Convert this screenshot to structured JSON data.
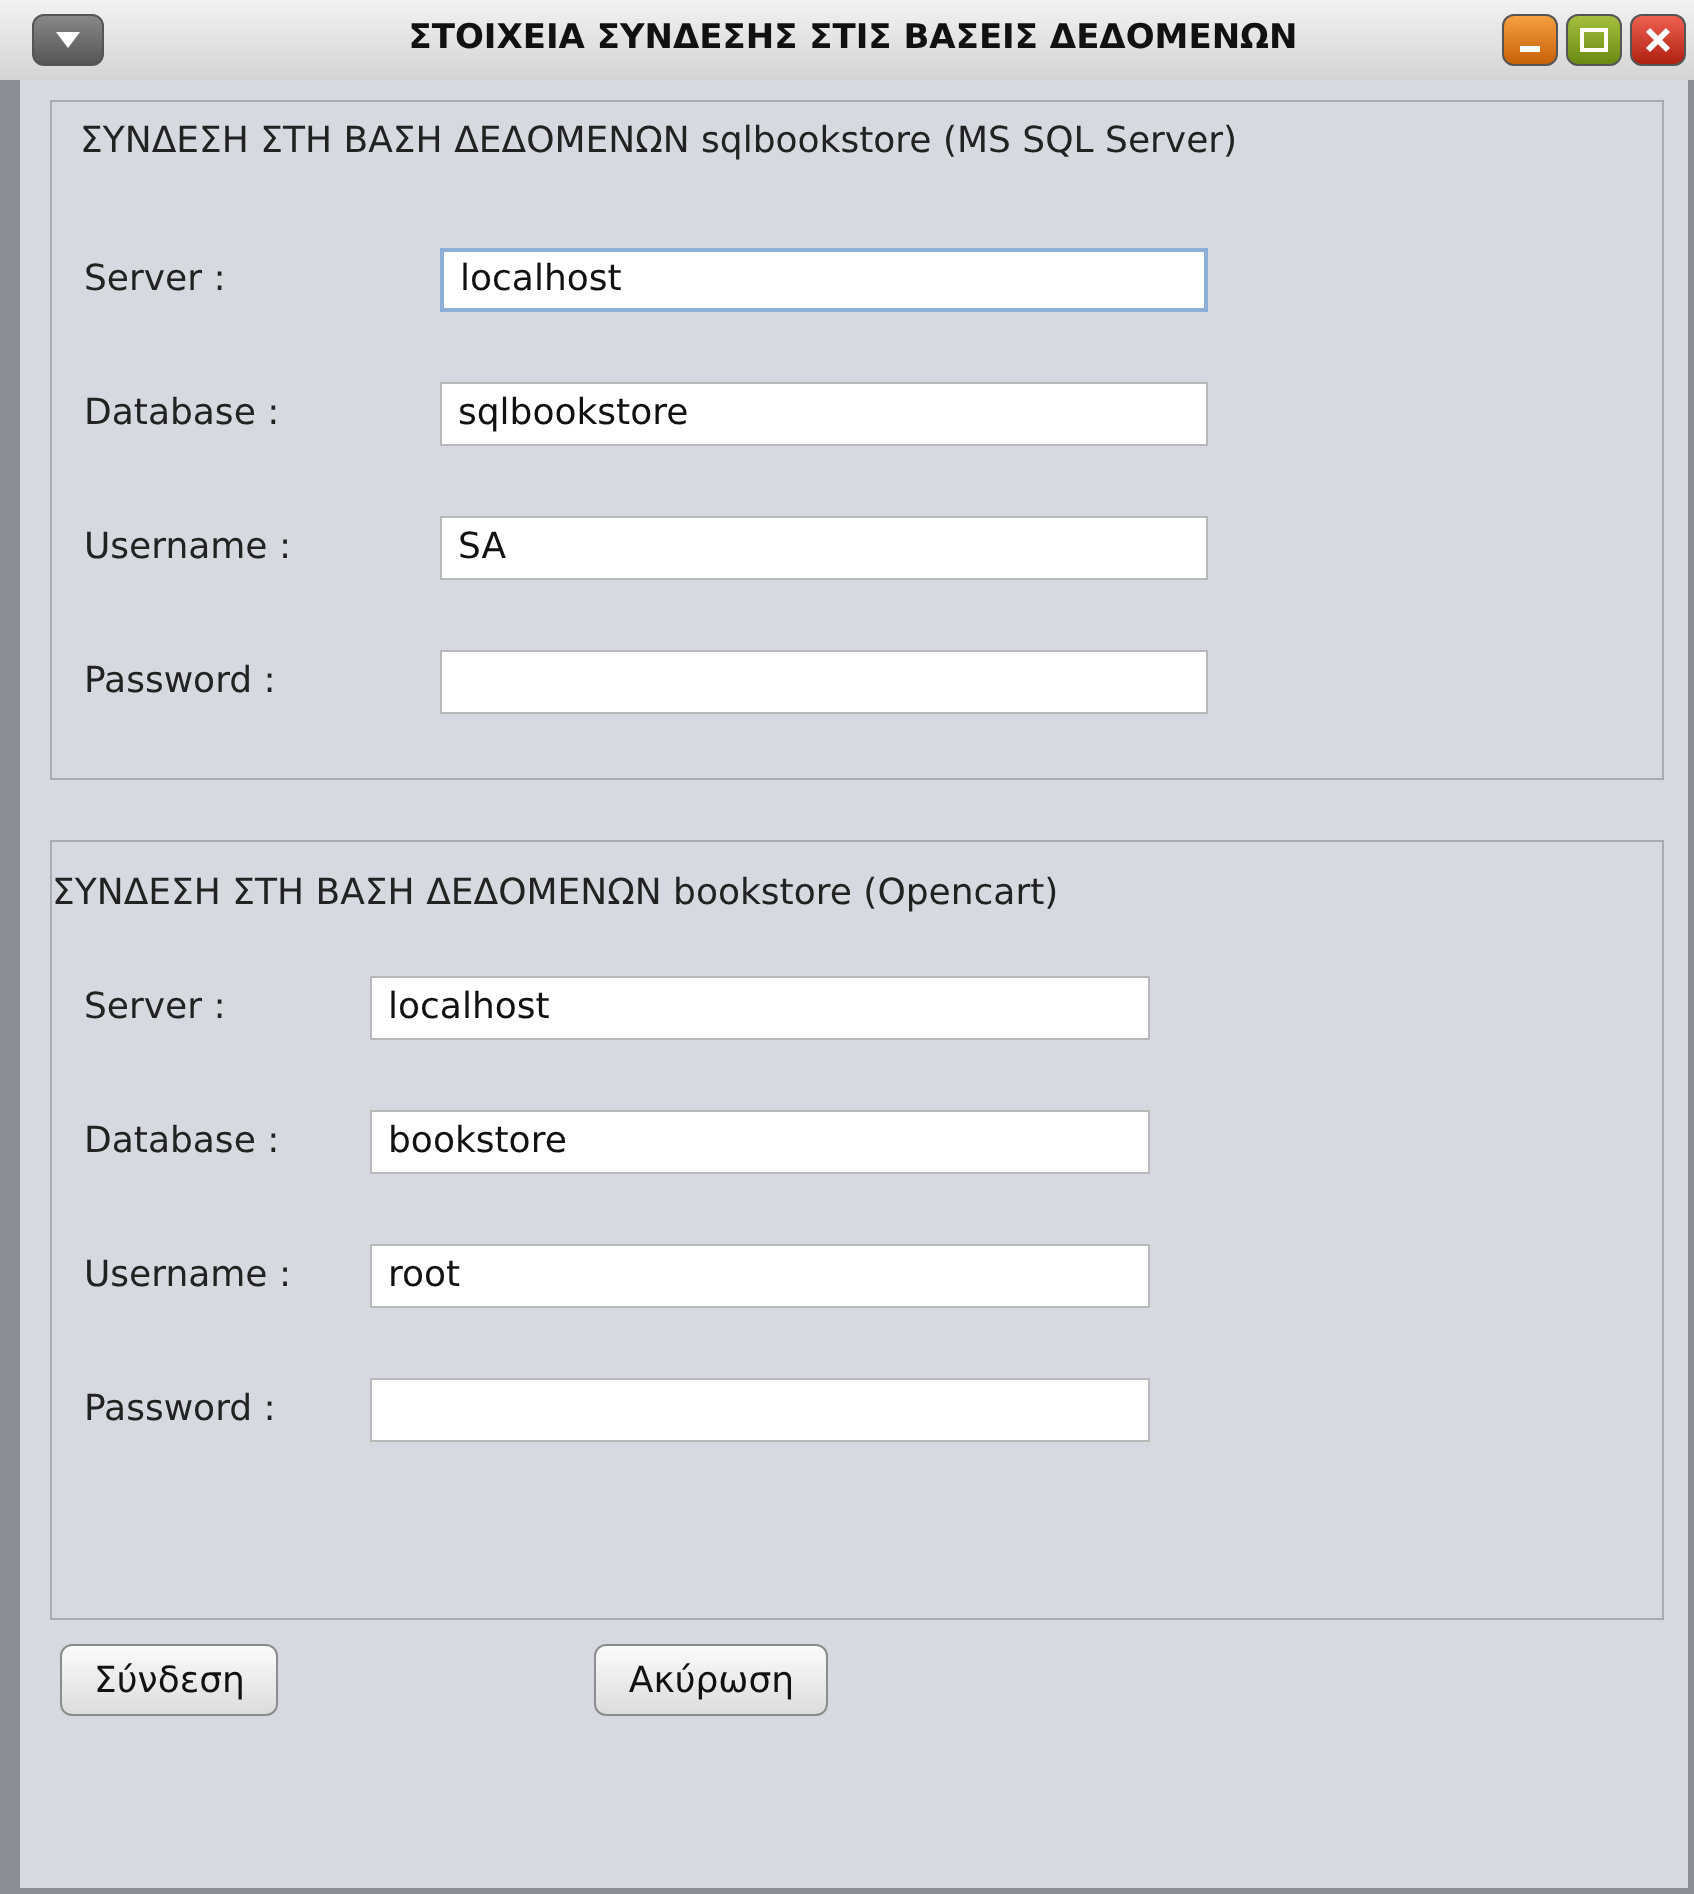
{
  "window": {
    "title": "ΣΤΟΙΧΕΙΑ ΣΥΝΔΕΣΗΣ ΣΤΙΣ ΒΑΣΕΙΣ ΔΕΔΟΜΕΝΩΝ"
  },
  "panels": [
    {
      "title": "ΣΥΝΔΕΣΗ ΣΤΗ ΒΑΣΗ ΔΕΔΟΜΕΝΩΝ sqlbookstore (MS SQL Server)",
      "fields": [
        {
          "label": "Server :",
          "value": "localhost",
          "focused": true
        },
        {
          "label": "Database :",
          "value": "sqlbookstore",
          "focused": false
        },
        {
          "label": "Username :",
          "value": "SA",
          "focused": false
        },
        {
          "label": "Password :",
          "focused": false
        }
      ]
    },
    {
      "title": "ΣΥΝΔΕΣΗ ΣΤΗ ΒΑΣΗ ΔΕΔΟΜΕΝΩΝ bookstore (Opencart)",
      "fields": [
        {
          "label": "Server :",
          "value": "localhost",
          "focused": false
        },
        {
          "label": "Database :",
          "value": "bookstore",
          "focused": false
        },
        {
          "label": "Username :",
          "value": "root",
          "focused": false
        },
        {
          "label": "Password :",
          "focused": false
        }
      ]
    }
  ],
  "buttons": [
    "Σύνδεση",
    "Ακύρωση"
  ]
}
